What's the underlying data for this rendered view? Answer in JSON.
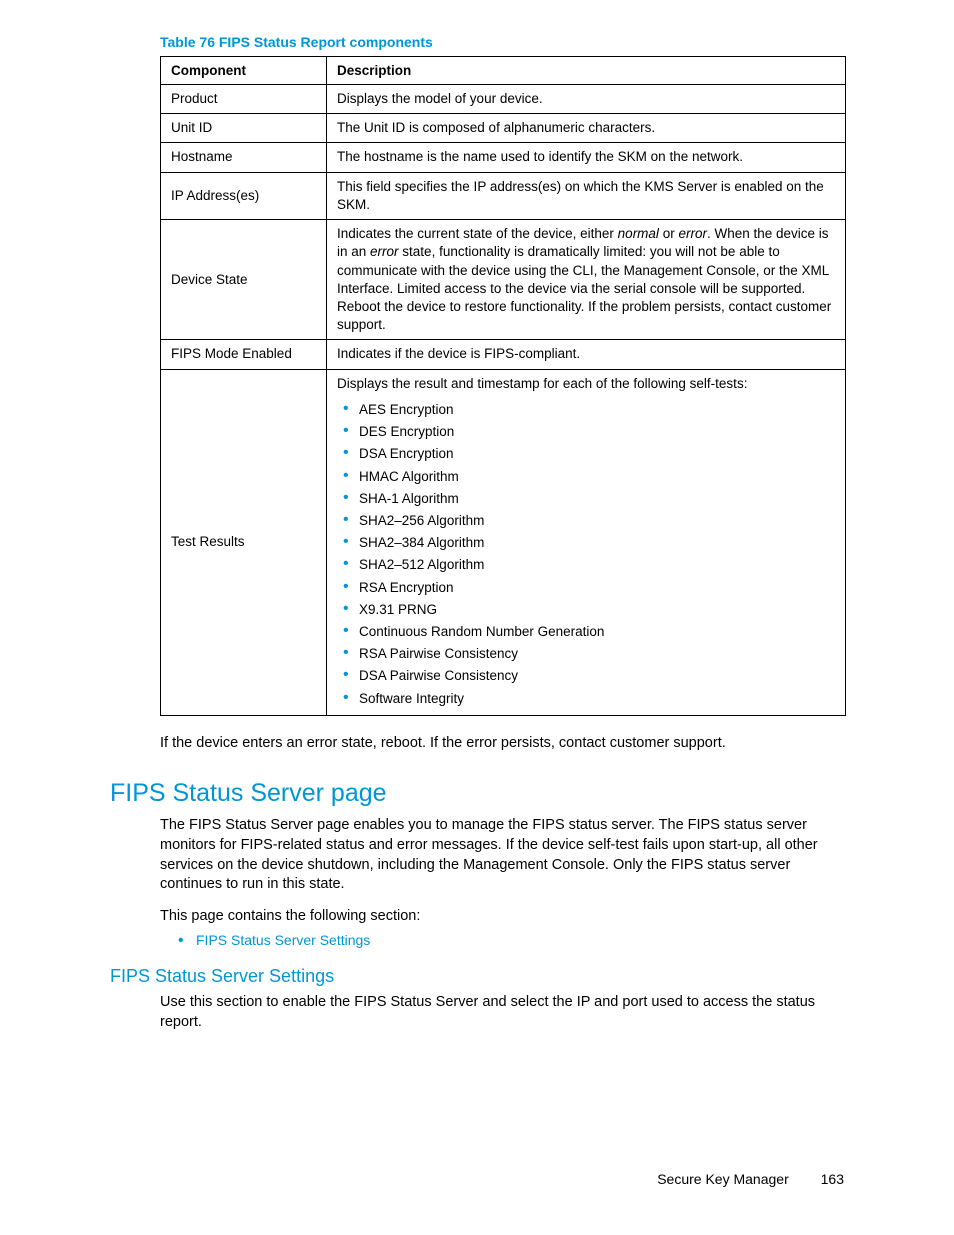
{
  "table": {
    "caption": "Table 76 FIPS Status Report components",
    "headers": {
      "component": "Component",
      "description": "Description"
    },
    "rows": [
      {
        "component": "Product",
        "description": "Displays the model of your device."
      },
      {
        "component": "Unit ID",
        "description": "The Unit ID is composed of alphanumeric characters."
      },
      {
        "component": "Hostname",
        "description": "The hostname is the name used to identify the SKM on the network."
      },
      {
        "component": "IP Address(es)",
        "description": "This field specifies the IP address(es) on which the KMS Server is enabled on the SKM."
      },
      {
        "component": "Device State",
        "description_pre": "Indicates the current state of the device, either ",
        "italic1": "normal",
        "mid1": " or ",
        "italic2": "error",
        "mid2": ".  When the device is in an ",
        "italic3": "error",
        "description_post": " state, functionality is dramatically limited: you will not be able to communicate with the device using the CLI, the Management Console, or the XML Interface. Limited access to the device via the serial console will be supported. Reboot the device to restore functionality. If the problem persists, contact customer support."
      },
      {
        "component": "FIPS Mode Enabled",
        "description": "Indicates if the device is FIPS-compliant."
      },
      {
        "component": "Test Results",
        "intro": "Displays the result and timestamp for each of the following self-tests:",
        "items": [
          "AES Encryption",
          "DES Encryption",
          "DSA Encryption",
          "HMAC Algorithm",
          "SHA-1 Algorithm",
          "SHA2–256 Algorithm",
          "SHA2–384 Algorithm",
          "SHA2–512 Algorithm",
          "RSA Encryption",
          "X9.31 PRNG",
          "Continuous Random Number Generation",
          "RSA Pairwise Consistency",
          "DSA Pairwise Consistency",
          "Software Integrity"
        ]
      }
    ]
  },
  "para1": "If the device enters an error state, reboot. If the error persists, contact customer support.",
  "section1": {
    "title": "FIPS Status Server page",
    "para": "The FIPS Status Server page enables you to manage the FIPS status server. The FIPS status server monitors for FIPS-related status and error messages. If the device self-test fails upon start-up, all other services on the device shutdown, including the Management Console. Only the FIPS status server continues to run in this state.",
    "para2": "This page contains the following section:",
    "list": [
      "FIPS Status Server Settings"
    ]
  },
  "section2": {
    "title": "FIPS Status Server Settings",
    "para": "Use this section to enable the FIPS Status Server and select the IP and port used to access the status report."
  },
  "footer": {
    "doc": "Secure Key Manager",
    "page": "163"
  }
}
